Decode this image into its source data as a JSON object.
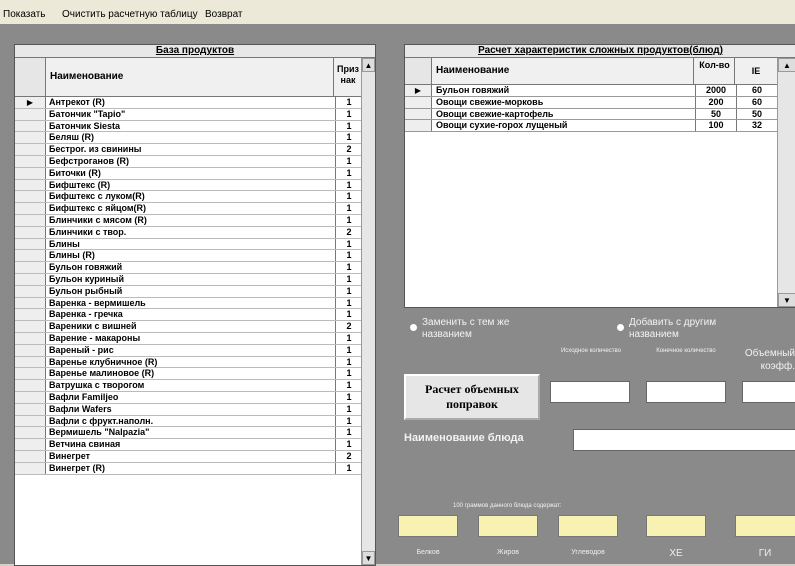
{
  "menu": [
    "Показать",
    "Очистить расчетную таблицу",
    "Возврат"
  ],
  "left_grid": {
    "caption": "База продуктов",
    "col_name": "Наименование",
    "col_flag": "Приз нак",
    "selected_marker": "▶",
    "rows": [
      {
        "name": "Антрекот (R)",
        "flag": "1"
      },
      {
        "name": "Батончик \"Tapio\"",
        "flag": "1"
      },
      {
        "name": "Батончик Siesta",
        "flag": "1"
      },
      {
        "name": "Беляш (R)",
        "flag": "1"
      },
      {
        "name": "Бестроr. из свинины",
        "flag": "2"
      },
      {
        "name": "Бефстроганов (R)",
        "flag": "1"
      },
      {
        "name": "Биточки (R)",
        "flag": "1"
      },
      {
        "name": "Бифштекс (R)",
        "flag": "1"
      },
      {
        "name": "Бифштекс с луком(R)",
        "flag": "1"
      },
      {
        "name": "Бифштекс с яйцом(R)",
        "flag": "1"
      },
      {
        "name": "Блинчики с мясом (R)",
        "flag": "1"
      },
      {
        "name": "Блинчики с твор.",
        "flag": "2"
      },
      {
        "name": "Блины",
        "flag": "1"
      },
      {
        "name": "Блины (R)",
        "flag": "1"
      },
      {
        "name": "Бульон говяжий",
        "flag": "1"
      },
      {
        "name": "Бульон куриный",
        "flag": "1"
      },
      {
        "name": "Бульон рыбный",
        "flag": "1"
      },
      {
        "name": "Варенка - вермишель",
        "flag": "1"
      },
      {
        "name": "Варенка - гречка",
        "flag": "1"
      },
      {
        "name": "Вареники с вишней",
        "flag": "2"
      },
      {
        "name": "Варение - макароны",
        "flag": "1"
      },
      {
        "name": "Вареный - рис",
        "flag": "1"
      },
      {
        "name": "Варенье клубничное (R)",
        "flag": "1"
      },
      {
        "name": "Варенье малиновое (R)",
        "flag": "1"
      },
      {
        "name": "Ватрушка с творогом",
        "flag": "1"
      },
      {
        "name": "Вафли Familjeo",
        "flag": "1"
      },
      {
        "name": "Вафли Wafers",
        "flag": "1"
      },
      {
        "name": "Вафли с фрукт.наполн.",
        "flag": "1"
      },
      {
        "name": "Вермишель \"Nalpazia\"",
        "flag": "1"
      },
      {
        "name": "Ветчина свиная",
        "flag": "1"
      },
      {
        "name": "Винегрет",
        "flag": "2"
      },
      {
        "name": "Винегрет (R)",
        "flag": "1"
      }
    ]
  },
  "right_grid": {
    "caption": "Расчет характеристик сложных продуктов(блюд)",
    "col_name": "Наименование",
    "col_qty": "Кол-во",
    "col_gi": "IE",
    "selected_marker": "▶",
    "rows": [
      {
        "name": "Бульон говяжий",
        "qty": "2000",
        "gi": "60"
      },
      {
        "name": "Овощи свежие-морковь",
        "qty": "200",
        "gi": "60"
      },
      {
        "name": "Овощи свежие-картофель",
        "qty": "50",
        "gi": "50"
      },
      {
        "name": "Овощи сухие-горох лущеный",
        "qty": "100",
        "gi": "32"
      }
    ]
  },
  "options": {
    "radio1": "Заменить с тем же названием",
    "radio2": "Добавить с другим названием"
  },
  "labels": {
    "start_qty": "Исходное количество",
    "end_qty": "Конечное количество",
    "coef": "Объемный коэфф.",
    "calc_button": "Расчет объемных поправок",
    "dish_name": "Наименование блюда",
    "per100": "100 граммов данного блюда содержат:",
    "protein": "Белков",
    "fat": "Жиров",
    "carbs": "Углеводов",
    "xe": "ХЕ",
    "gi": "ГИ"
  }
}
